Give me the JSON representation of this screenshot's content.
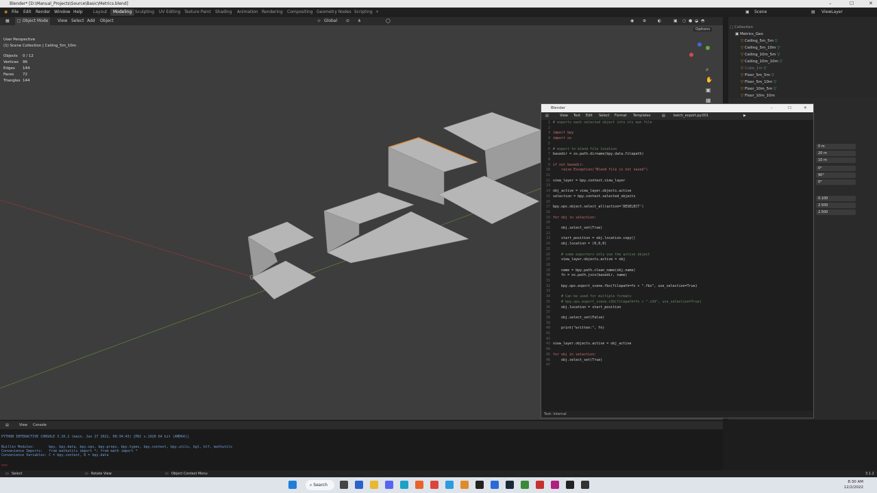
{
  "window_title": "Blender* [D:\\Manual_Projects\\Source\\Basic\\Metrics.blend]",
  "menu": [
    "File",
    "Edit",
    "Render",
    "Window",
    "Help"
  ],
  "workspaces": [
    "Layout",
    "Modeling",
    "Sculpting",
    "UV Editing",
    "Texture Paint",
    "Shading",
    "Animation",
    "Rendering",
    "Compositing",
    "Geometry Nodes",
    "Scripting",
    "+"
  ],
  "active_workspace": "Modeling",
  "scene": {
    "label": "Scene",
    "view_layer": "ViewLayer"
  },
  "header": {
    "mode": "Object Mode",
    "items": [
      "View",
      "Select",
      "Add",
      "Object"
    ],
    "orientation": "Global",
    "options": "Options"
  },
  "viewport": {
    "perspective": "User Perspective",
    "collection": "(1) Scene Collection | Ceiling_5m_10m",
    "stats": [
      {
        "k": "Objects",
        "v": "0 / 12"
      },
      {
        "k": "Vertices",
        "v": "96"
      },
      {
        "k": "Edges",
        "v": "144"
      },
      {
        "k": "Faces",
        "v": "72"
      },
      {
        "k": "Triangles",
        "v": "144"
      }
    ],
    "colors": {
      "bg": "#3d3d3d",
      "mesh": "#b3b3b3",
      "selected": "#e0882a",
      "axis_x": "#a6403f",
      "axis_y": "#6a9a3a"
    }
  },
  "outliner": {
    "root": "Collection",
    "group": "Metrics_Geo",
    "items": [
      "Ceiling_5m_5m",
      "Ceiling_5m_10m",
      "Ceiling_10m_5m",
      "Ceiling_10m_10m",
      "Cube_1m",
      "Floor_5m_5m",
      "Floor_5m_10m",
      "Floor_10m_5m",
      "Floor_10m_10m"
    ]
  },
  "properties": {
    "location": [
      "0 m",
      "20 m",
      "10 m"
    ],
    "rotation": [
      "0°",
      "90°",
      "0°"
    ],
    "scale": [
      "0.100",
      "2.500",
      "2.500"
    ]
  },
  "text_editor": {
    "title": "Blender",
    "menu": [
      "View",
      "Text",
      "Edit",
      "Select",
      "Format",
      "Templates"
    ],
    "filename": "batch_export.py.001",
    "status": "Text: Internal",
    "lines": [
      "# exports each selected object into its own file",
      "",
      "import bpy",
      "import os",
      "",
      "# export to blend file location",
      "basedir = os.path.dirname(bpy.data.filepath)",
      "",
      "if not basedir:",
      "    raise Exception(\"Blend file is not saved\")",
      "",
      "view_layer = bpy.context.view_layer",
      "",
      "obj_active = view_layer.objects.active",
      "selection = bpy.context.selected_objects",
      "",
      "bpy.ops.object.select_all(action='DESELECT')",
      "",
      "for obj in selection:",
      "",
      "    obj.select_set(True)",
      "",
      "    start_position = obj.location.copy()",
      "    obj.location = (0,0,0)",
      "",
      "    # some exporters only use the active object",
      "    view_layer.objects.active = obj",
      "",
      "    name = bpy.path.clean_name(obj.name)",
      "    fn = os.path.join(basedir, name)",
      "",
      "    bpy.ops.export_scene.fbx(filepath=fn + \".fbx\", use_selection=True)",
      "",
      "    # Can be used for multiple formats",
      "    # bpy.ops.export_scene.x3d(filepath=fn + \".x3d\", use_selection=True)",
      "    obj.location = start_position",
      "",
      "    obj.select_set(False)",
      "",
      "    print(\"written:\", fn)",
      "",
      "",
      "view_layer.objects.active = obj_active",
      "",
      "for obj in selection:",
      "    obj.select_set(True)",
      ""
    ]
  },
  "console": {
    "header": [
      "View",
      "Console"
    ],
    "lines": [
      "PYTHON INTERACTIVE CONSOLE 3.10.2 (main, Jan 27 2022, 08:34:43) [MSC v.1928 64 bit (AMD64)]",
      "",
      "Builtin Modules:       bpy, bpy.data, bpy.ops, bpy.props, bpy.types, bpy.context, bpy.utils, bgl, blf, mathutils",
      "Convenience Imports:   from mathutils import *; from math import *",
      "Convenience Variables: C = bpy.context, D = bpy.data",
      "",
      ">>> "
    ]
  },
  "statusbar": {
    "left": "Select",
    "mid": "Rotate View",
    "right": "Object Context Menu",
    "version": "3.1.2"
  },
  "taskbar": {
    "search": "Search",
    "time": "8:30 AM",
    "date": "12/2/2022"
  }
}
